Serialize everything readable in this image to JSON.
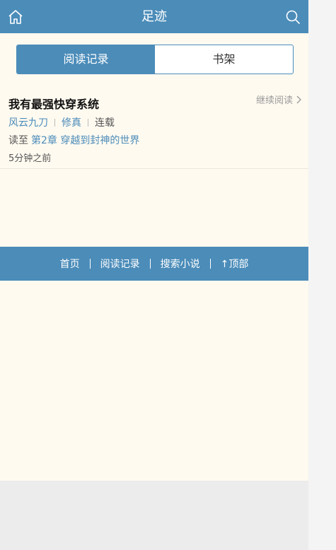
{
  "header": {
    "title": "足迹"
  },
  "tabs": [
    {
      "label": "阅读记录",
      "active": true
    },
    {
      "label": "书架",
      "active": false
    }
  ],
  "book": {
    "name": "我有最强快穿系统",
    "continue_label": "继续阅读",
    "author": "风云九刀",
    "category": "修真",
    "status": "连载",
    "progress_prefix": "读至",
    "chapter": "第2章 穿越到封神的世界",
    "time": "5分钟之前"
  },
  "footer": {
    "items": [
      "首页",
      "阅读记录",
      "搜索小说",
      "↑顶部"
    ]
  },
  "colors": {
    "accent": "#4b8cb9",
    "background": "#fffaf0"
  }
}
